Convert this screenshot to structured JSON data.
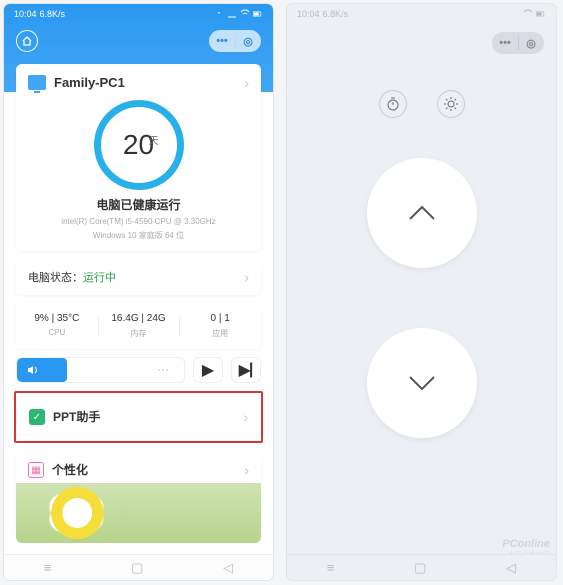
{
  "status": {
    "time": "10:04",
    "net": "6.8K/s"
  },
  "colors": {
    "accent": "#2a98f1",
    "success": "#2aa24e",
    "highlight": "#d23a3a"
  },
  "phone1": {
    "device": {
      "name": "Family-PC1"
    },
    "health": {
      "days": "20",
      "unit": "天",
      "text": "电脑已健康运行",
      "spec1": "intel(R) Core(TM) i5-4590 CPU @ 3.30GHz",
      "spec2": "Windows 10 家庭版 64 位"
    },
    "status": {
      "label": "电脑状态：",
      "value": "运行中"
    },
    "stats": [
      {
        "v": "9% | 35°C",
        "l": "CPU"
      },
      {
        "v": "16.4G | 24G",
        "l": "内存"
      },
      {
        "v": "0 | 1",
        "l": "应用"
      }
    ],
    "items": [
      {
        "icon_bg": "#2bb673",
        "icon_glyph": "✓",
        "label": "PPT助手",
        "highlighted": true
      },
      {
        "icon_bg": "#f06eaa",
        "icon_glyph": "▦",
        "label": "个性化",
        "highlighted": false
      }
    ]
  },
  "watermark": {
    "brand": "PConline",
    "sub": "太平洋电脑网"
  }
}
